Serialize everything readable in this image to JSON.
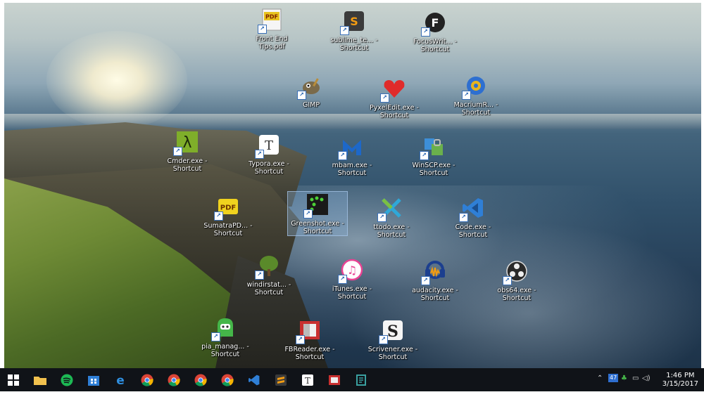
{
  "desktop": {
    "icons": [
      {
        "id": "pdf-frontend",
        "label": "Front End Tips.pdf",
        "icon": "pdf-file-icon",
        "color": "#e8c21e"
      },
      {
        "id": "sublime",
        "label": "sublime_te... - Shortcut",
        "icon": "sublime-text-icon",
        "color": "#3b3b3b"
      },
      {
        "id": "focuswriter",
        "label": "FocusWrit... - Shortcut",
        "icon": "focuswriter-icon",
        "color": "#222222"
      },
      {
        "id": "gimp",
        "label": "GIMP",
        "icon": "gimp-icon",
        "color": "#6b5a3a"
      },
      {
        "id": "pyxeledit",
        "label": "PyxelEdit.exe - Shortcut",
        "icon": "pyxel-heart-icon",
        "color": "#e02b2b"
      },
      {
        "id": "macrium",
        "label": "MacriumR... - Shortcut",
        "icon": "macrium-icon",
        "color": "#2e6fd0"
      },
      {
        "id": "cmder",
        "label": "Cmder.exe - Shortcut",
        "icon": "lambda-icon",
        "color": "#7fae2a"
      },
      {
        "id": "typora",
        "label": "Typora.exe - Shortcut",
        "icon": "typora-icon",
        "color": "#ffffff"
      },
      {
        "id": "mbam",
        "label": "mbam.exe - Shortcut",
        "icon": "malwarebytes-icon",
        "color": "#1d68c9"
      },
      {
        "id": "winscp",
        "label": "WinSCP.exe - Shortcut",
        "icon": "winscp-icon",
        "color": "#3d8fd8"
      },
      {
        "id": "sumatra",
        "label": "SumatraPD... - Shortcut",
        "icon": "sumatra-pdf-icon",
        "color": "#f0d21e"
      },
      {
        "id": "greenshot",
        "label": "Greenshot.exe - Shortcut",
        "icon": "greenshot-icon",
        "color": "#1a1a1a"
      },
      {
        "id": "todo",
        "label": "ttodo.exe - Shortcut",
        "icon": "todo-x-icon",
        "color": "#2fa8d8"
      },
      {
        "id": "vscode",
        "label": "Code.exe - Shortcut",
        "icon": "vscode-icon",
        "color": "#2f7fd6"
      },
      {
        "id": "windirstat",
        "label": "windirstat... - Shortcut",
        "icon": "windirstat-tree-icon",
        "color": "#5a8a2a"
      },
      {
        "id": "itunes",
        "label": "iTunes.exe - Shortcut",
        "icon": "itunes-icon",
        "color": "#ffffff"
      },
      {
        "id": "audacity",
        "label": "audacity.exe - Shortcut",
        "icon": "audacity-icon",
        "color": "#1c3f8f"
      },
      {
        "id": "obs",
        "label": "obs64.exe - Shortcut",
        "icon": "obs-icon",
        "color": "#2a2a2a"
      },
      {
        "id": "pia",
        "label": "pia_manag... - Shortcut",
        "icon": "pia-robot-icon",
        "color": "#45b649"
      },
      {
        "id": "foxit",
        "label": "FBReader.exe - Shortcut",
        "icon": "fbreader-icon",
        "color": "#c93030"
      },
      {
        "id": "scrivener",
        "label": "Scrivener.exe - Shortcut",
        "icon": "scrivener-icon",
        "color": "#222222"
      }
    ]
  },
  "taskbar": {
    "items": [
      {
        "name": "start-button",
        "icon": "windows-logo-icon",
        "color": "#ffffff"
      },
      {
        "name": "taskbar-file-explorer",
        "icon": "folder-icon",
        "color": "#f2c14e"
      },
      {
        "name": "taskbar-spotify",
        "icon": "spotify-icon",
        "color": "#1db954"
      },
      {
        "name": "taskbar-store",
        "icon": "store-icon",
        "color": "#2f7fd6"
      },
      {
        "name": "taskbar-edge",
        "icon": "edge-icon",
        "color": "#2f8fe0"
      },
      {
        "name": "taskbar-chrome-1",
        "icon": "chrome-icon",
        "color": "#db4437"
      },
      {
        "name": "taskbar-chrome-2",
        "icon": "chrome-icon",
        "color": "#db4437"
      },
      {
        "name": "taskbar-chrome-3",
        "icon": "chrome-icon",
        "color": "#db4437"
      },
      {
        "name": "taskbar-chrome-4",
        "icon": "chrome-icon",
        "color": "#db4437"
      },
      {
        "name": "taskbar-vscode",
        "icon": "vscode-icon",
        "color": "#2f7fd6"
      },
      {
        "name": "taskbar-sublime",
        "icon": "sublime-text-icon",
        "color": "#f39c12"
      },
      {
        "name": "taskbar-typora",
        "icon": "typora-icon",
        "color": "#ffffff"
      },
      {
        "name": "taskbar-foxit",
        "icon": "reader-icon",
        "color": "#c93030"
      },
      {
        "name": "taskbar-app",
        "icon": "app-icon",
        "color": "#3aa0a0"
      }
    ],
    "tray": {
      "badge": "47",
      "clock_time": "1:46 PM",
      "clock_date": "3/15/2017"
    }
  }
}
